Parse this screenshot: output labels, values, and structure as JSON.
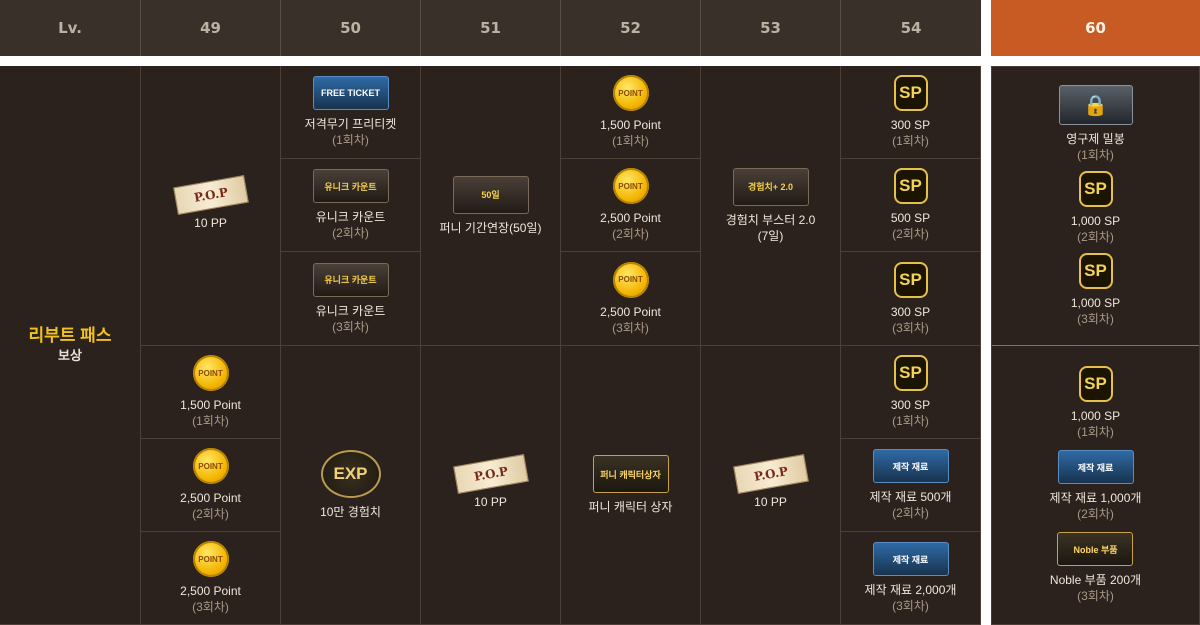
{
  "header": {
    "lv": "Lv.",
    "levels": [
      "49",
      "50",
      "51",
      "52",
      "53",
      "54"
    ],
    "level_final": "60"
  },
  "row_label": {
    "title": "리부트 패스",
    "subtitle": "보상"
  },
  "icons": {
    "pp": "P.O.P",
    "point": "POINT",
    "sp": "SP",
    "exp": "EXP",
    "sniper_ticket": "FREE TICKET",
    "unique_count": "유니크 카운트",
    "funny_ext": "50일",
    "funny_box": "퍼니 캐릭터상자",
    "booster": "경험치+ 2.0",
    "material": "제작 재료",
    "noble": "Noble 부품"
  },
  "cells": {
    "c49a": {
      "name": "10 PP",
      "count": ""
    },
    "c49b": {
      "name": "1,500 Point",
      "count": "(1회차)"
    },
    "c49c": {
      "name": "2,500 Point",
      "count": "(2회차)"
    },
    "c49d": {
      "name": "2,500 Point",
      "count": "(3회차)"
    },
    "c50a": {
      "name": "저격무기 프리티켓",
      "count": "(1회차)"
    },
    "c50b": {
      "name": "유니크 카운트",
      "count": "(2회차)"
    },
    "c50c": {
      "name": "유니크 카운트",
      "count": "(3회차)"
    },
    "c50d": {
      "name": "10만 경험치",
      "count": ""
    },
    "c51a": {
      "name": "퍼니 기간연장(50일)",
      "count": ""
    },
    "c51b": {
      "name": "10 PP",
      "count": ""
    },
    "c52a": {
      "name": "1,500 Point",
      "count": "(1회차)"
    },
    "c52b": {
      "name": "2,500 Point",
      "count": "(2회차)"
    },
    "c52c": {
      "name": "2,500 Point",
      "count": "(3회차)"
    },
    "c52d": {
      "name": "퍼니 캐릭터 상자",
      "count": ""
    },
    "c53a": {
      "name": "경험치 부스터 2.0",
      "count": "(7일)"
    },
    "c53b": {
      "name": "10 PP",
      "count": ""
    },
    "c54a": {
      "name": "300 SP",
      "count": "(1회차)"
    },
    "c54b": {
      "name": "500 SP",
      "count": "(2회차)"
    },
    "c54c": {
      "name": "300 SP",
      "count": "(3회차)"
    },
    "c54d": {
      "name": "300 SP",
      "count": "(1회차)"
    },
    "c54e": {
      "name": "제작 재료 500개",
      "count": "(2회차)"
    },
    "c54f": {
      "name": "제작 재료 2,000개",
      "count": "(3회차)"
    },
    "c60a": {
      "name": "영구제 밀봉",
      "count": "(1회차)"
    },
    "c60b": {
      "name": "1,000 SP",
      "count": "(2회차)"
    },
    "c60c": {
      "name": "1,000 SP",
      "count": "(3회차)"
    },
    "c60d": {
      "name": "1,000 SP",
      "count": "(1회차)"
    },
    "c60e": {
      "name": "제작 재료 1,000개",
      "count": "(2회차)"
    },
    "c60f": {
      "name": "Noble 부품 200개",
      "count": "(3회차)"
    }
  },
  "colors": {
    "header_bg": "#3a302a",
    "header_accent": "#c85a24",
    "body_bg": "#2b221d",
    "title_gold": "#f3c11f"
  }
}
